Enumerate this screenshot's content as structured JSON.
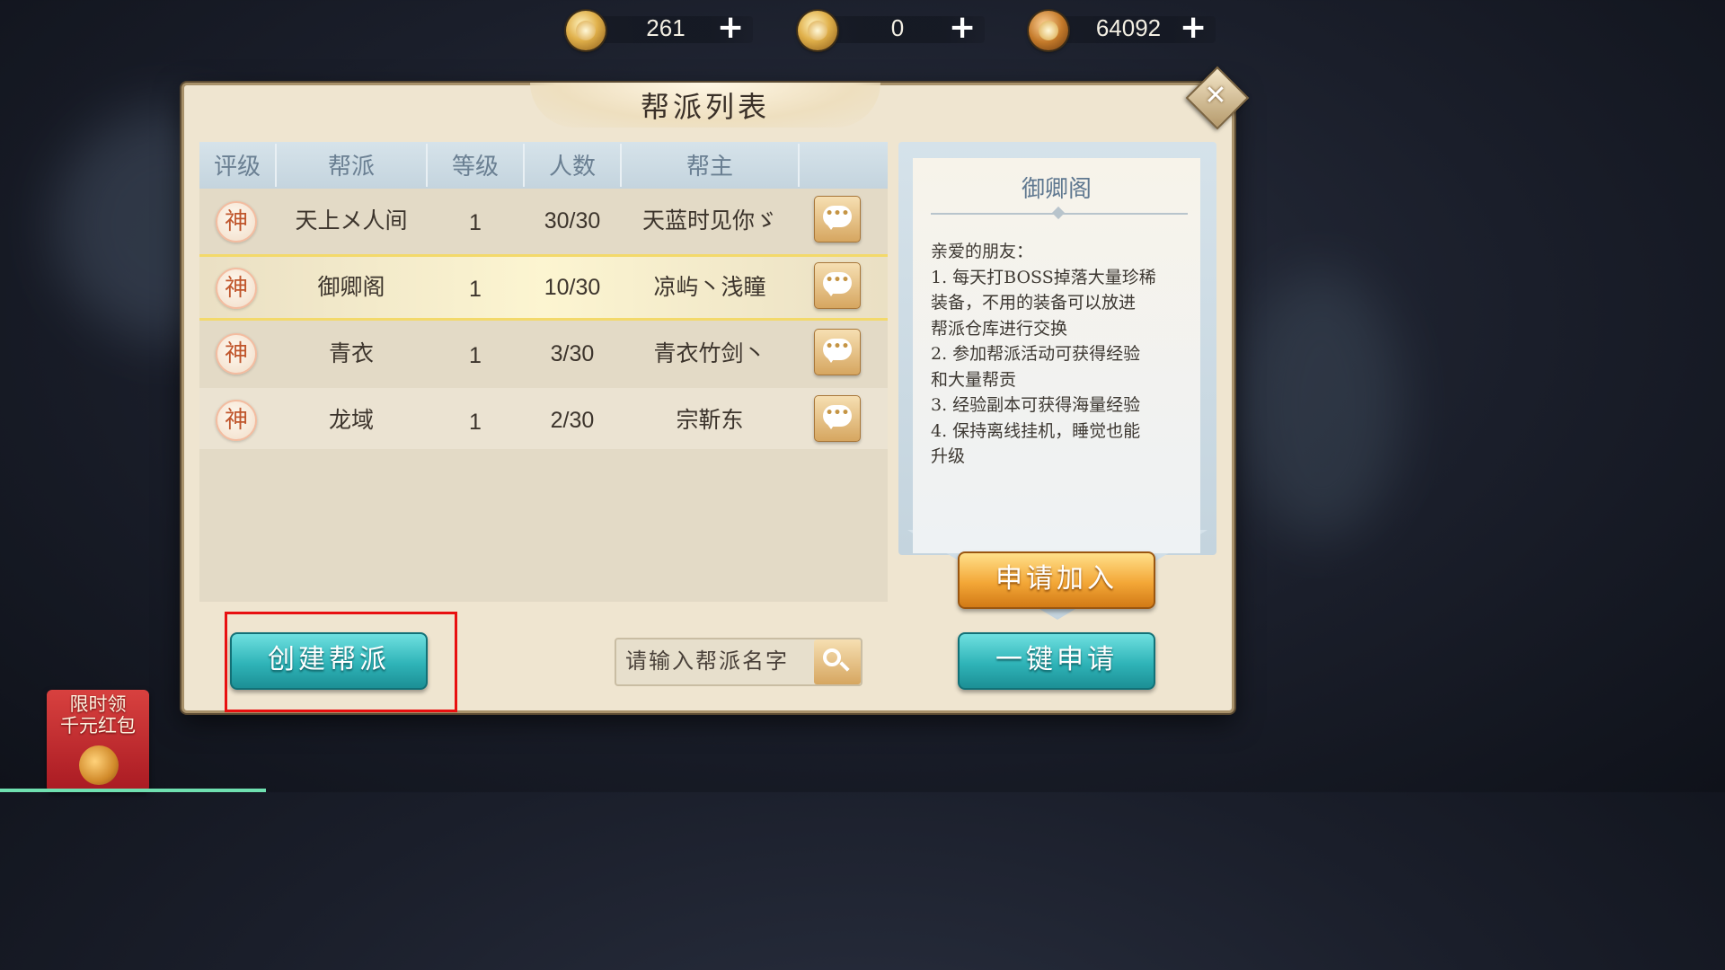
{
  "currencies": [
    {
      "name": "bound-ingot",
      "value": "261"
    },
    {
      "name": "ingot",
      "value": "0"
    },
    {
      "name": "coin",
      "value": "64092"
    }
  ],
  "plus_label": "+",
  "panel": {
    "title": "帮派列表",
    "close_label": "✕"
  },
  "table": {
    "headers": [
      "评级",
      "帮派",
      "等级",
      "人数",
      "帮主"
    ],
    "rows": [
      {
        "rank": "神",
        "name": "天上メ人间",
        "level": "1",
        "members": "30/30",
        "leader": "天蓝时见你ゞ"
      },
      {
        "rank": "神",
        "name": "御卿阁",
        "level": "1",
        "members": "10/30",
        "leader": "凉屿丶浅瞳"
      },
      {
        "rank": "神",
        "name": "青衣",
        "level": "1",
        "members": "3/30",
        "leader": "青衣竹剑丶"
      },
      {
        "rank": "神",
        "name": "龙域",
        "level": "1",
        "members": "2/30",
        "leader": "宗靳东"
      }
    ]
  },
  "chat_icon_glyph": "•••",
  "info": {
    "title": "御卿阁",
    "lines": [
      "亲爱的朋友：",
      "1. 每天打BOSS掉落大量珍稀",
      "装备，不用的装备可以放进",
      "帮派仓库进行交换",
      "2. 参加帮派活动可获得经验",
      "和大量帮贡",
      "3. 经验副本可获得海量经验",
      "4. 保持离线挂机，睡觉也能",
      "升级"
    ]
  },
  "buttons": {
    "apply": "申请加入",
    "create": "创建帮派",
    "one_click": "一键申请"
  },
  "search": {
    "placeholder": "请输入帮派名字"
  },
  "promo": {
    "line1": "限时领",
    "line2": "千元红包"
  },
  "colors": {
    "highlight": "#e81010",
    "teal_button": "#2fb4b8",
    "gold_button": "#f3a737"
  }
}
